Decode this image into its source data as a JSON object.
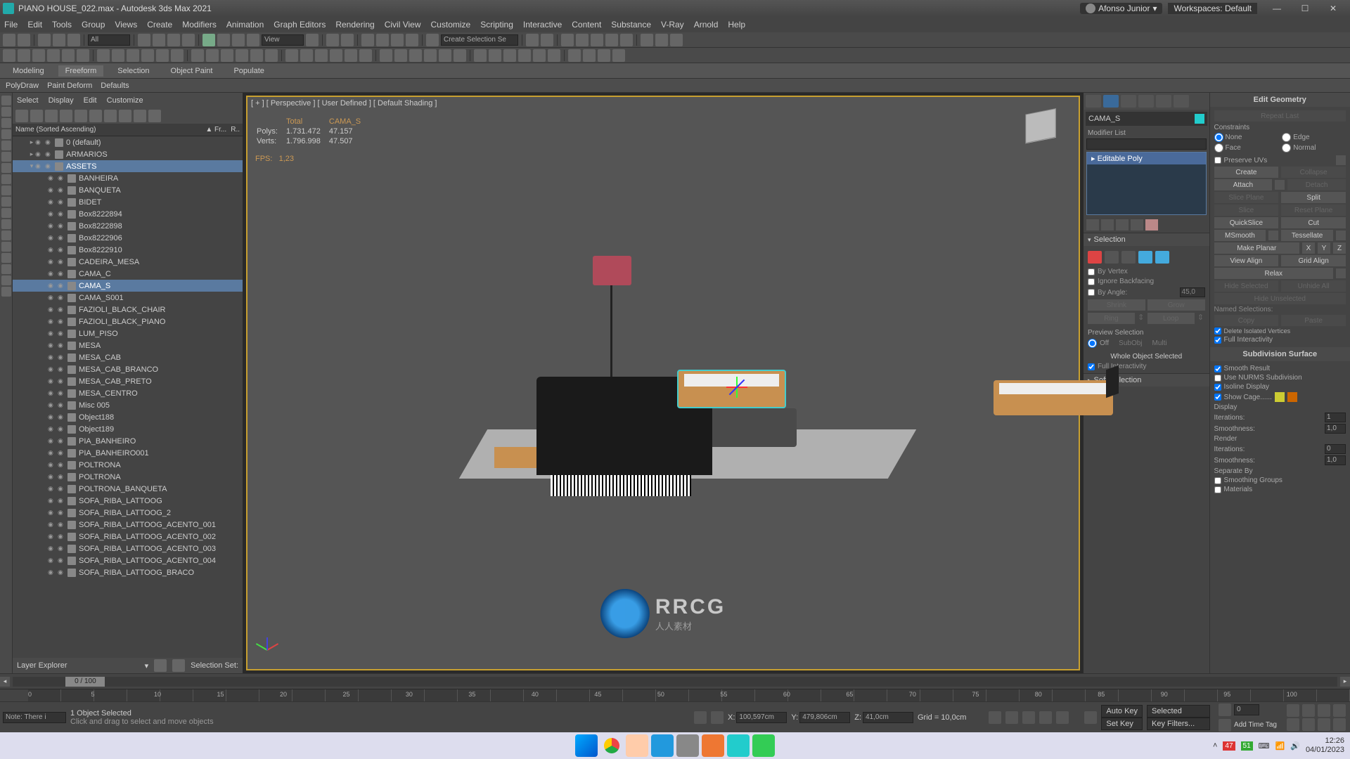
{
  "titlebar": {
    "filename": "PIANO HOUSE_022.max - Autodesk 3ds Max 2021",
    "user": "Afonso Junior",
    "workspace_label": "Workspaces:",
    "workspace_value": "Default"
  },
  "menubar": [
    "File",
    "Edit",
    "Tools",
    "Group",
    "Views",
    "Create",
    "Modifiers",
    "Animation",
    "Graph Editors",
    "Rendering",
    "Civil View",
    "Customize",
    "Scripting",
    "Interactive",
    "Content",
    "Substance",
    "V-Ray",
    "Arnold",
    "Help"
  ],
  "toolbar_dd1": "All",
  "toolbar_dd2": "View",
  "toolbar_sel_input": "Create Selection Se",
  "ribbon": {
    "tabs": [
      "Modeling",
      "Freeform",
      "Selection",
      "Object Paint",
      "Populate"
    ],
    "active": 1
  },
  "subribbon": [
    "PolyDraw",
    "Paint Deform",
    "Defaults"
  ],
  "explorer": {
    "tabs": [
      "Select",
      "Display",
      "Edit",
      "Customize"
    ],
    "col1": "Name (Sorted Ascending)",
    "col2": "▲ Fr...",
    "col3": "R..",
    "footer_label": "Layer Explorer",
    "sel_set_label": "Selection Set:",
    "items": [
      {
        "d": 0,
        "n": "0 (default)",
        "exp": "▸"
      },
      {
        "d": 0,
        "n": "ARMARIOS",
        "exp": "▸"
      },
      {
        "d": 0,
        "n": "ASSETS",
        "exp": "▾",
        "sel": true
      },
      {
        "d": 1,
        "n": "BANHEIRA"
      },
      {
        "d": 1,
        "n": "BANQUETA"
      },
      {
        "d": 1,
        "n": "BIDET"
      },
      {
        "d": 1,
        "n": "Box8222894"
      },
      {
        "d": 1,
        "n": "Box8222898"
      },
      {
        "d": 1,
        "n": "Box8222906"
      },
      {
        "d": 1,
        "n": "Box8222910"
      },
      {
        "d": 1,
        "n": "CADEIRA_MESA"
      },
      {
        "d": 1,
        "n": "CAMA_C"
      },
      {
        "d": 1,
        "n": "CAMA_S",
        "hl": true
      },
      {
        "d": 1,
        "n": "CAMA_S001"
      },
      {
        "d": 1,
        "n": "FAZIOLI_BLACK_CHAIR"
      },
      {
        "d": 1,
        "n": "FAZIOLI_BLACK_PIANO"
      },
      {
        "d": 1,
        "n": "LUM_PISO"
      },
      {
        "d": 1,
        "n": "MESA"
      },
      {
        "d": 1,
        "n": "MESA_CAB"
      },
      {
        "d": 1,
        "n": "MESA_CAB_BRANCO"
      },
      {
        "d": 1,
        "n": "MESA_CAB_PRETO"
      },
      {
        "d": 1,
        "n": "MESA_CENTRO"
      },
      {
        "d": 1,
        "n": "Misc 005"
      },
      {
        "d": 1,
        "n": "Object188"
      },
      {
        "d": 1,
        "n": "Object189"
      },
      {
        "d": 1,
        "n": "PIA_BANHEIRO"
      },
      {
        "d": 1,
        "n": "PIA_BANHEIRO001"
      },
      {
        "d": 1,
        "n": "POLTRONA"
      },
      {
        "d": 1,
        "n": "POLTRONA"
      },
      {
        "d": 1,
        "n": "POLTRONA_BANQUETA"
      },
      {
        "d": 1,
        "n": "SOFA_RIBA_LATTOOG"
      },
      {
        "d": 1,
        "n": "SOFA_RIBA_LATTOOG_2"
      },
      {
        "d": 1,
        "n": "SOFA_RIBA_LATTOOG_ACENTO_001"
      },
      {
        "d": 1,
        "n": "SOFA_RIBA_LATTOOG_ACENTO_002"
      },
      {
        "d": 1,
        "n": "SOFA_RIBA_LATTOOG_ACENTO_003"
      },
      {
        "d": 1,
        "n": "SOFA_RIBA_LATTOOG_ACENTO_004"
      },
      {
        "d": 1,
        "n": "SOFA_RIBA_LATTOOG_BRACO"
      }
    ]
  },
  "viewport": {
    "label": "[ + ] [ Perspective ] [ User Defined ] [ Default Shading ]",
    "stats": {
      "h_total": "Total",
      "h_sel": "CAMA_S",
      "polys_l": "Polys:",
      "polys_t": "1.731.472",
      "polys_s": "47.157",
      "verts_l": "Verts:",
      "verts_t": "1.796.998",
      "verts_s": "47.507",
      "fps_l": "FPS:",
      "fps_v": "1,23"
    }
  },
  "cmd": {
    "obj_name": "CAMA_S",
    "modlist_label": "Modifier List",
    "mod_item": "Editable Poly",
    "rollout_selection": "Selection",
    "by_vertex": "By Vertex",
    "ignore_bf": "Ignore Backfacing",
    "by_angle": "By Angle:",
    "by_angle_val": "45,0",
    "shrink": "Shrink",
    "grow": "Grow",
    "ring": "Ring",
    "loop": "Loop",
    "preview_sel": "Preview Selection",
    "off": "Off",
    "subobj": "SubObj",
    "multi": "Multi",
    "whole": "Whole Object Selected",
    "full_inter": "Full Interactivity",
    "rollout_softsel": "Soft Selection"
  },
  "eg": {
    "title": "Edit Geometry",
    "repeat": "Repeat Last",
    "constraints": "Constraints",
    "none": "None",
    "edge": "Edge",
    "face": "Face",
    "normal": "Normal",
    "preserve": "Preserve UVs",
    "create": "Create",
    "collapse": "Collapse",
    "attach": "Attach",
    "detach": "Detach",
    "slice_plane": "Slice Plane",
    "split": "Split",
    "slice": "Slice",
    "reset_plane": "Reset Plane",
    "quickslice": "QuickSlice",
    "cut": "Cut",
    "msmooth": "MSmooth",
    "tessellate": "Tessellate",
    "make_planar": "Make Planar",
    "x": "X",
    "y": "Y",
    "z": "Z",
    "view_align": "View Align",
    "grid_align": "Grid Align",
    "relax": "Relax",
    "hide_sel": "Hide Selected",
    "unhide": "Unhide All",
    "hide_unsel": "Hide Unselected",
    "named_sel": "Named Selections:",
    "copy": "Copy",
    "paste": "Paste",
    "del_iso": "Delete Isolated Vertices",
    "full_inter": "Full Interactivity",
    "subdiv_title": "Subdivision Surface",
    "smooth_result": "Smooth Result",
    "use_nurms": "Use NURMS Subdivision",
    "isoline": "Isoline Display",
    "show_cage": "Show Cage......",
    "display": "Display",
    "render": "Render",
    "iterations": "Iterations:",
    "iter_d": "1",
    "iter_r": "0",
    "smoothness": "Smoothness:",
    "smooth_d": "1,0",
    "smooth_r": "1,0",
    "separate": "Separate By",
    "sm_groups": "Smoothing Groups",
    "materials": "Materials"
  },
  "timeline": {
    "frame": "0 / 100",
    "ticks": [
      0,
      5,
      10,
      15,
      20,
      25,
      30,
      35,
      40,
      45,
      50,
      55,
      60,
      65,
      70,
      75,
      80,
      85,
      90,
      95,
      100
    ]
  },
  "status": {
    "note": "Note: There i",
    "sel": "1 Object Selected",
    "hint": "Click and drag to select and move objects",
    "x_l": "X:",
    "x": "100,597cm",
    "y_l": "Y:",
    "y": "479,806cm",
    "z_l": "Z:",
    "z": "41,0cm",
    "grid": "Grid = 10,0cm",
    "autokey": "Auto Key",
    "setkey": "Set Key",
    "selected": "Selected",
    "keyfilters": "Key Filters...",
    "addtag": "Add Time Tag",
    "frame": "0"
  },
  "watermark": {
    "text": "RRCG",
    "sub": "人人素材"
  },
  "tray": {
    "t1": "47",
    "t2": "51",
    "time": "12:26",
    "date": "04/01/2023"
  }
}
